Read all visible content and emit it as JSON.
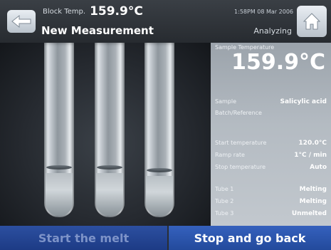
{
  "header": {
    "block_temp_label": "Block Temp.",
    "block_temp_value": "159.9°C",
    "datetime": "1:58PM 08 Mar 2006",
    "title": "New Measurement",
    "status": "Analyzing"
  },
  "icons": {
    "back": "arrow-left-icon",
    "home": "home-icon"
  },
  "camera": {
    "tube_count": 3
  },
  "info": {
    "sample_temp_label": "Sample Temperature",
    "sample_temp_value": "159.9°C",
    "rows": [
      {
        "label": "Sample",
        "value": "Salicylic acid"
      },
      {
        "label": "Batch/Reference",
        "value": ""
      },
      {
        "label": "Start temperature",
        "value": "120.0°C"
      },
      {
        "label": "Ramp rate",
        "value": "1°C / min"
      },
      {
        "label": "Stop temperature",
        "value": "Auto"
      },
      {
        "label": "Tube 1",
        "value": "Melting"
      },
      {
        "label": "Tube 2",
        "value": "Melting"
      },
      {
        "label": "Tube 3",
        "value": "Unmelted"
      }
    ]
  },
  "buttons": {
    "start": "Start the melt",
    "stop": "Stop and go back"
  },
  "colors": {
    "button_blue": "#234a9c",
    "header_dark": "#2a2e33",
    "panel_gray": "#b4bbc2"
  }
}
